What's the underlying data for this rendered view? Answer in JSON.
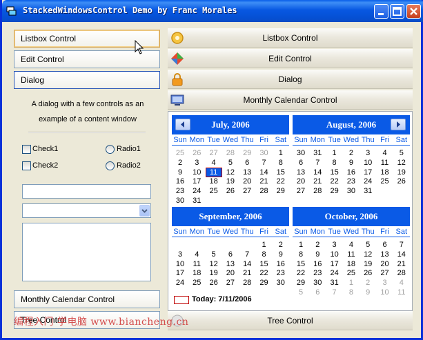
{
  "window": {
    "title": "StackedWindowsControl Demo by Franc Morales"
  },
  "left": {
    "buttons": {
      "listbox": "Listbox Control",
      "edit": "Edit Control",
      "dialog": "Dialog",
      "calendar": "Monthly Calendar Control",
      "tree": "Tree Control"
    },
    "dialog": {
      "text": "A dialog with a few controls as an example of a content window",
      "check1": "Check1",
      "check2": "Check2",
      "radio1": "Radio1",
      "radio2": "Radio2",
      "edit_value": "",
      "combo_value": "",
      "memo_value": ""
    }
  },
  "right": {
    "headers": {
      "listbox": "Listbox Control",
      "edit": "Edit Control",
      "dialog": "Dialog",
      "calendar": "Monthly Calendar Control",
      "tree": "Tree Control"
    },
    "day_names": [
      "Sun",
      "Mon",
      "Tue",
      "Wed",
      "Thu",
      "Fri",
      "Sat"
    ],
    "months": [
      {
        "title": "July, 2006",
        "nav": "prev",
        "days": [
          [
            "25",
            "26",
            "27",
            "28",
            "29",
            "30",
            "1"
          ],
          [
            "2",
            "3",
            "4",
            "5",
            "6",
            "7",
            "8"
          ],
          [
            "9",
            "10",
            "11",
            "12",
            "13",
            "14",
            "15"
          ],
          [
            "16",
            "17",
            "18",
            "19",
            "20",
            "21",
            "22"
          ],
          [
            "23",
            "24",
            "25",
            "26",
            "27",
            "28",
            "29"
          ],
          [
            "30",
            "31",
            "",
            "",
            "",
            "",
            ""
          ]
        ],
        "gray": [
          0,
          1,
          2,
          3,
          4,
          5
        ],
        "today_index": 16
      },
      {
        "title": "August, 2006",
        "nav": "next",
        "days": [
          [
            "30",
            "31",
            "1",
            "2",
            "3",
            "4",
            "5"
          ],
          [
            "6",
            "7",
            "8",
            "9",
            "10",
            "11",
            "12"
          ],
          [
            "13",
            "14",
            "15",
            "16",
            "17",
            "18",
            "19"
          ],
          [
            "20",
            "21",
            "22",
            "23",
            "24",
            "25",
            "26"
          ],
          [
            "27",
            "28",
            "29",
            "30",
            "31",
            "",
            ""
          ]
        ],
        "gray": [],
        "today_index": -1
      },
      {
        "title": "September, 2006",
        "days": [
          [
            "",
            "",
            "",
            "",
            "",
            "1",
            "2"
          ],
          [
            "3",
            "4",
            "5",
            "6",
            "7",
            "8",
            "9"
          ],
          [
            "10",
            "11",
            "12",
            "13",
            "14",
            "15",
            "16"
          ],
          [
            "17",
            "18",
            "19",
            "20",
            "21",
            "22",
            "23"
          ],
          [
            "24",
            "25",
            "26",
            "27",
            "28",
            "29",
            "30"
          ]
        ],
        "gray": [],
        "today_index": -1
      },
      {
        "title": "October, 2006",
        "days": [
          [
            "1",
            "2",
            "3",
            "4",
            "5",
            "6",
            "7"
          ],
          [
            "8",
            "9",
            "10",
            "11",
            "12",
            "13",
            "14"
          ],
          [
            "15",
            "16",
            "17",
            "18",
            "19",
            "20",
            "21"
          ],
          [
            "22",
            "23",
            "24",
            "25",
            "26",
            "27",
            "28"
          ],
          [
            "29",
            "30",
            "31",
            "1",
            "2",
            "3",
            "4"
          ],
          [
            "5",
            "6",
            "7",
            "8",
            "9",
            "10",
            "11"
          ]
        ],
        "gray": [
          31,
          32,
          33,
          34,
          35,
          36,
          37,
          38,
          39,
          40,
          41
        ],
        "today_index": -1
      }
    ],
    "today_text": "Today: 7/11/2006"
  },
  "watermark": "编程入门 学电脑 www.biancheng.cn"
}
